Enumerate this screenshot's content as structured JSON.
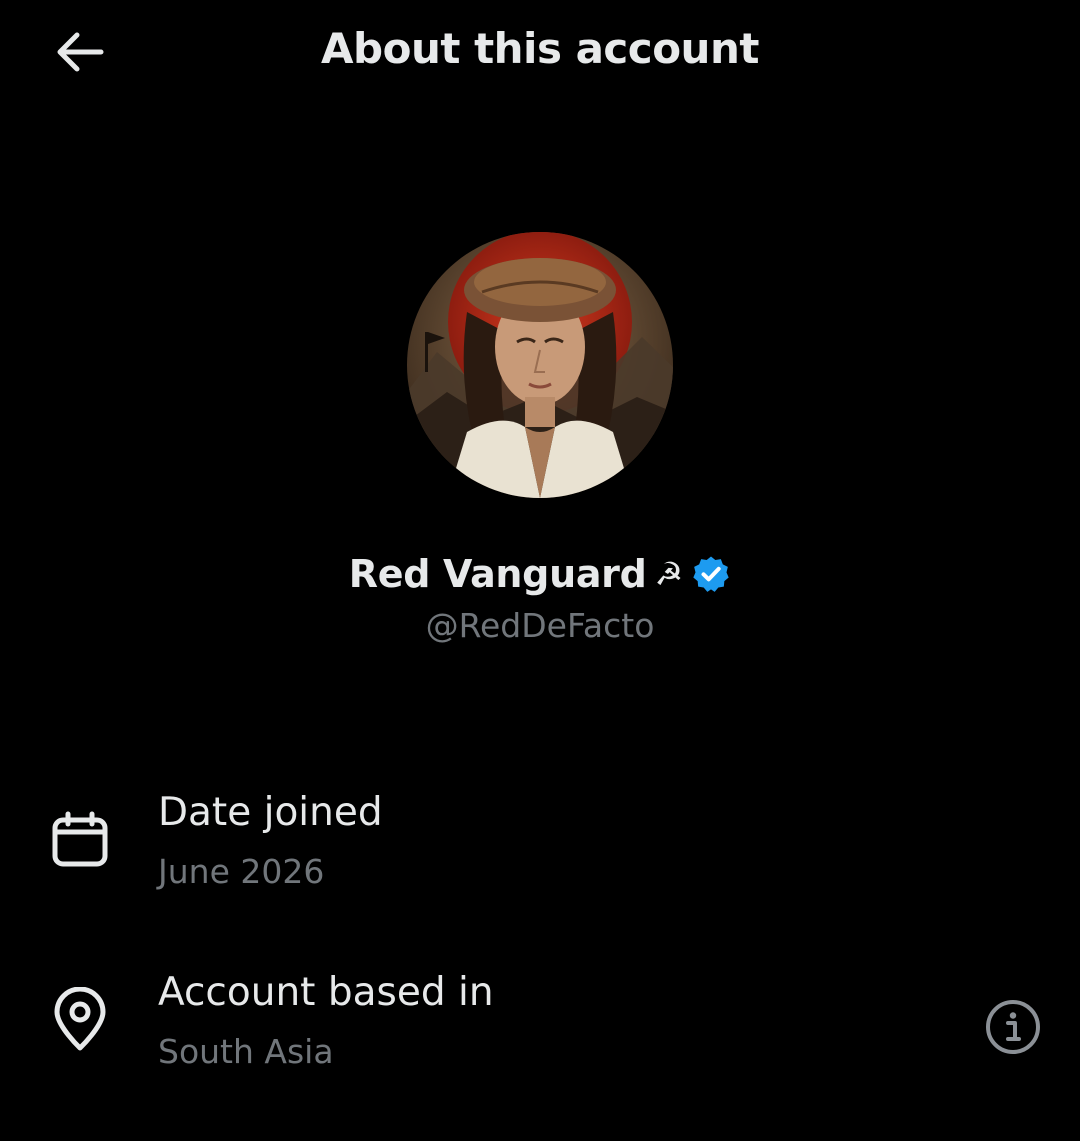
{
  "header": {
    "title": "About this account",
    "back_icon": "arrow-left-icon"
  },
  "profile": {
    "display_name": "Red Vanguard",
    "name_emoji": "☭",
    "verified_icon": "verified-badge-icon",
    "verified_color": "#1d9bf0",
    "handle": "@RedDeFacto"
  },
  "details": {
    "date_joined": {
      "icon": "calendar-icon",
      "label": "Date joined",
      "value": "June 2026"
    },
    "account_based_in": {
      "icon": "location-pin-icon",
      "label": "Account based in",
      "value": "South Asia",
      "info_icon": "info-icon"
    }
  },
  "colors": {
    "background": "#000000",
    "primary_text": "#e7e9ea",
    "secondary_text": "#71767b"
  }
}
